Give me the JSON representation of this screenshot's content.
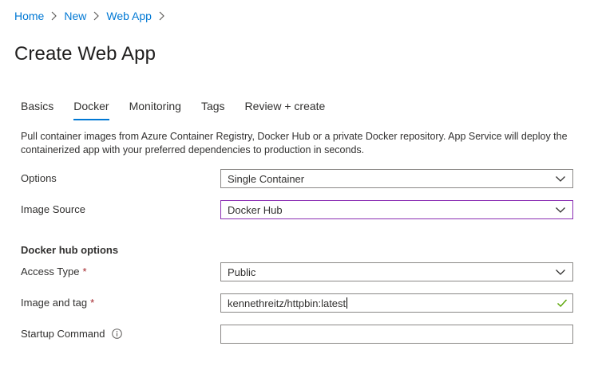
{
  "breadcrumb": {
    "items": [
      {
        "label": "Home"
      },
      {
        "label": "New"
      },
      {
        "label": "Web App"
      }
    ]
  },
  "page": {
    "title": "Create Web App"
  },
  "tabs": [
    {
      "label": "Basics",
      "active": false
    },
    {
      "label": "Docker",
      "active": true
    },
    {
      "label": "Monitoring",
      "active": false
    },
    {
      "label": "Tags",
      "active": false
    },
    {
      "label": "Review + create",
      "active": false
    }
  ],
  "description": "Pull container images from Azure Container Registry, Docker Hub or a private Docker repository. App Service will deploy the containerized app with your preferred dependencies to production in seconds.",
  "form": {
    "options": {
      "label": "Options",
      "value": "Single Container"
    },
    "image_source": {
      "label": "Image Source",
      "value": "Docker Hub"
    },
    "section_title": "Docker hub options",
    "access_type": {
      "label": "Access Type",
      "required_mark": "*",
      "value": "Public"
    },
    "image_and_tag": {
      "label": "Image and tag",
      "required_mark": "*",
      "value": "kennethreitz/httpbin:latest"
    },
    "startup_command": {
      "label": "Startup Command",
      "value": ""
    }
  },
  "icons": {
    "chevron": "chevron-down-icon",
    "breadcrumb_separator": "chevron-right-icon",
    "valid": "checkmark-icon",
    "info": "info-icon"
  },
  "colors": {
    "link": "#0078d4",
    "active_tab_underline": "#0078d4",
    "focused_border": "#8a2db3",
    "required": "#a4262c",
    "valid_check": "#57a300"
  }
}
